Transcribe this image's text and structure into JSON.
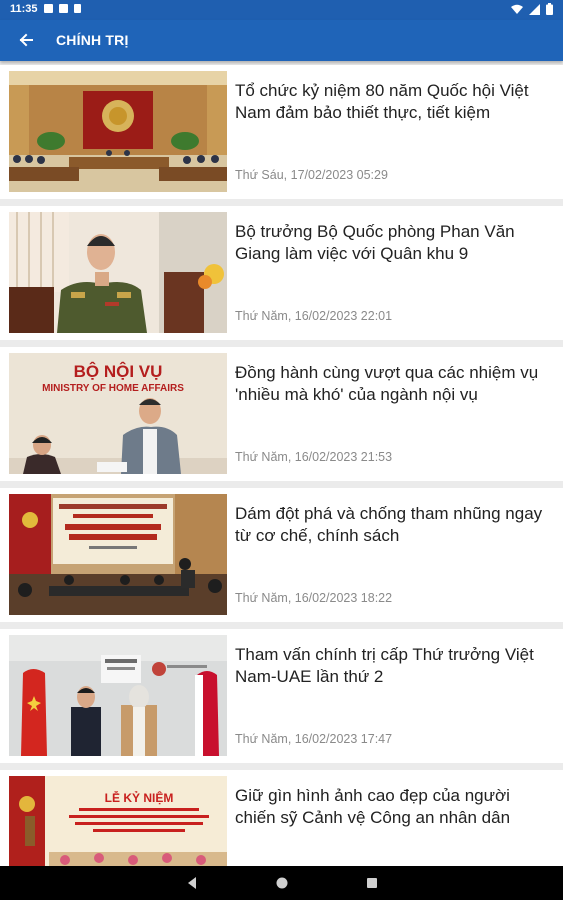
{
  "status_bar": {
    "time": "11:35",
    "icons": [
      "notification-icon",
      "sim-icon",
      "storage-icon"
    ],
    "right_icons": [
      "wifi-icon",
      "signal-icon",
      "battery-icon"
    ]
  },
  "app_bar": {
    "title": "CHÍNH TRỊ",
    "back_icon": "arrow-left-icon",
    "background": "#1f64b8"
  },
  "articles": [
    {
      "headline": "Tổ chức kỷ niệm 80 năm Quốc hội Việt Nam đảm bảo thiết thực, tiết kiệm",
      "date": "Thứ Sáu, 17/02/2023 05:29"
    },
    {
      "headline": "Bộ trưởng Bộ Quốc phòng Phan Văn Giang làm việc với Quân khu 9",
      "date": "Thứ Năm, 16/02/2023 22:01"
    },
    {
      "headline": "Đồng hành cùng vượt qua các nhiệm vụ 'nhiều mà khó' của ngành nội vụ",
      "date": "Thứ Năm, 16/02/2023 21:53",
      "thumb_text": [
        "BỘ NỘI VỤ",
        "MINISTRY OF HOME AFFAIRS"
      ]
    },
    {
      "headline": "Dám đột phá và chống tham nhũng ngay từ cơ chế, chính sách",
      "date": "Thứ Năm, 16/02/2023 18:22"
    },
    {
      "headline": "Tham vấn chính trị cấp Thứ trưởng Việt Nam-UAE lần thứ 2",
      "date": "Thứ Năm, 16/02/2023 17:47"
    },
    {
      "headline": "Giữ gìn hình ảnh cao đẹp của người chiến sỹ Cảnh vệ Công an nhân dân",
      "date": "",
      "thumb_text": [
        "LỄ KỶ NIỆM"
      ]
    }
  ],
  "nav_bar": {
    "buttons": [
      "back-triangle-icon",
      "home-circle-icon",
      "recents-square-icon"
    ]
  }
}
